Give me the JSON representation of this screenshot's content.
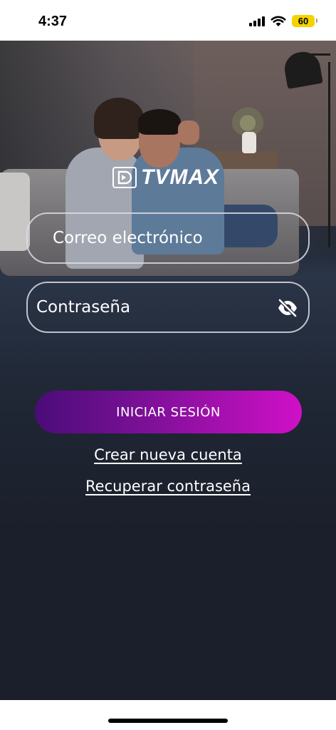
{
  "status_bar": {
    "time": "4:37",
    "battery_level": "60",
    "battery_color": "#f5d300"
  },
  "brand": {
    "logo_text": "TVMAX"
  },
  "login_form": {
    "email_placeholder": "Correo electrónico",
    "password_placeholder": "Contraseña",
    "password_toggle_icon": "eye-slash-icon",
    "submit_label": "INICIAR SESIÓN",
    "create_account_link": "Crear nueva cuenta",
    "recover_password_link": "Recuperar contraseña"
  },
  "colors": {
    "background": "#1b1f2b",
    "button_gradient_start": "#4a0c78",
    "button_gradient_end": "#d010c8",
    "field_border": "#dcdce4"
  }
}
